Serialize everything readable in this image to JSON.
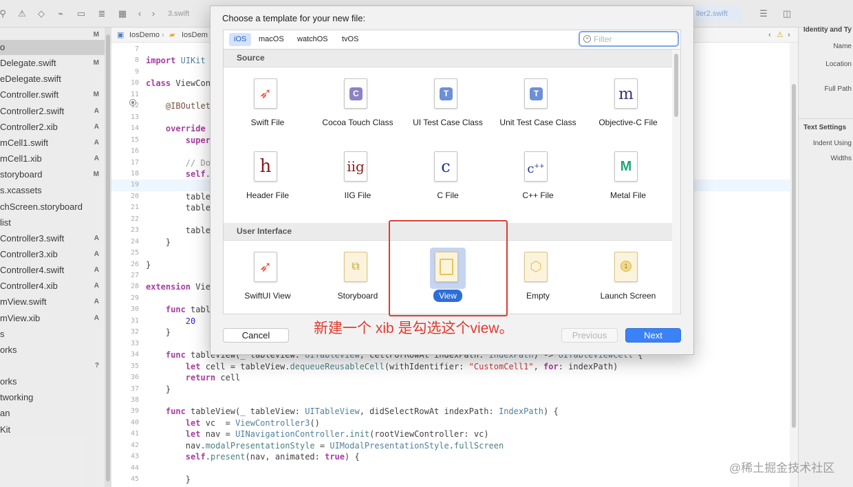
{
  "toolbar": {
    "tabs": [
      "3.swift",
      "ller2.swift"
    ]
  },
  "navigator": {
    "header_status": "M",
    "items": [
      {
        "name": "o",
        "status": "",
        "selected": true
      },
      {
        "name": "Delegate.swift",
        "status": "M"
      },
      {
        "name": "eDelegate.swift",
        "status": ""
      },
      {
        "name": "Controller.swift",
        "status": "M"
      },
      {
        "name": "Controller2.swift",
        "status": "A"
      },
      {
        "name": "Controller2.xib",
        "status": "A"
      },
      {
        "name": "mCell1.swift",
        "status": "A"
      },
      {
        "name": "mCell1.xib",
        "status": "A"
      },
      {
        "name": "storyboard",
        "status": "M"
      },
      {
        "name": "s.xcassets",
        "status": ""
      },
      {
        "name": "chScreen.storyboard",
        "status": ""
      },
      {
        "name": "list",
        "status": ""
      },
      {
        "name": "Controller3.swift",
        "status": "A"
      },
      {
        "name": "Controller3.xib",
        "status": "A"
      },
      {
        "name": "Controller4.swift",
        "status": "A"
      },
      {
        "name": "Controller4.xib",
        "status": "A"
      },
      {
        "name": "mView.swift",
        "status": "A"
      },
      {
        "name": "mView.xib",
        "status": "A"
      },
      {
        "name": "s",
        "status": ""
      },
      {
        "name": "orks",
        "status": ""
      },
      {
        "name": "",
        "status": "?"
      },
      {
        "name": "orks",
        "status": ""
      },
      {
        "name": "tworking",
        "status": ""
      },
      {
        "name": "an",
        "status": ""
      },
      {
        "name": "Kit",
        "status": ""
      }
    ]
  },
  "jumpbar": {
    "project": "IosDemo",
    "folder": "IosDem"
  },
  "editor": {
    "lines": [
      {
        "n": "7",
        "code": ""
      },
      {
        "n": "8",
        "code": "import UIKit"
      },
      {
        "n": "9",
        "code": ""
      },
      {
        "n": "10",
        "code": "class ViewCon"
      },
      {
        "n": "11",
        "code": ""
      },
      {
        "n": "12",
        "code": "    @IBOutlet"
      },
      {
        "n": "13",
        "code": ""
      },
      {
        "n": "14",
        "code": "    override"
      },
      {
        "n": "15",
        "code": "        super"
      },
      {
        "n": "16",
        "code": ""
      },
      {
        "n": "17",
        "code": "        // Do"
      },
      {
        "n": "18",
        "code": "        self."
      },
      {
        "n": "19",
        "code": ""
      },
      {
        "n": "20",
        "code": "        table"
      },
      {
        "n": "21",
        "code": "        table"
      },
      {
        "n": "22",
        "code": ""
      },
      {
        "n": "23",
        "code": "        table"
      },
      {
        "n": "24",
        "code": "    }"
      },
      {
        "n": "25",
        "code": ""
      },
      {
        "n": "26",
        "code": "}"
      },
      {
        "n": "27",
        "code": ""
      },
      {
        "n": "28",
        "code": "extension Vie"
      },
      {
        "n": "29",
        "code": ""
      },
      {
        "n": "30",
        "code": "    func table"
      },
      {
        "n": "31",
        "code": "        20"
      },
      {
        "n": "32",
        "code": "    }"
      },
      {
        "n": "33",
        "code": ""
      },
      {
        "n": "34",
        "code": "    func tableView(_ tableView: UITableView, cellForRowAt indexPath: IndexPath) -> UITableViewCell {"
      },
      {
        "n": "35",
        "code": "        let cell = tableView.dequeueReusableCell(withIdentifier: \"CustomCell1\", for: indexPath)"
      },
      {
        "n": "36",
        "code": "        return cell"
      },
      {
        "n": "37",
        "code": "    }"
      },
      {
        "n": "38",
        "code": ""
      },
      {
        "n": "39",
        "code": "    func tableView(_ tableView: UITableView, didSelectRowAt indexPath: IndexPath) {"
      },
      {
        "n": "40",
        "code": "        let vc  = ViewController3()"
      },
      {
        "n": "41",
        "code": "        let nav = UINavigationController.init(rootViewController: vc)"
      },
      {
        "n": "42",
        "code": "        nav.modalPresentationStyle = UIModalPresentationStyle.fullScreen"
      },
      {
        "n": "43",
        "code": "        self.present(nav, animated: true) {"
      },
      {
        "n": "44",
        "code": ""
      },
      {
        "n": "45",
        "code": "        }"
      }
    ]
  },
  "inspector": {
    "identity_title": "Identity and Ty",
    "name_label": "Name",
    "location_label": "Location",
    "full_path_label": "Full Path",
    "text_settings_title": "Text Settings",
    "indent_label": "Indent Using",
    "widths_label": "Widths"
  },
  "dialog": {
    "title": "Choose a template for your new file:",
    "platforms": [
      "iOS",
      "macOS",
      "watchOS",
      "tvOS"
    ],
    "selected_platform": "iOS",
    "filter_placeholder": "Filter",
    "sections": [
      {
        "header": "Source",
        "templates": [
          {
            "label": "Swift File",
            "icon": "swift-file-icon"
          },
          {
            "label": "Cocoa Touch Class",
            "icon": "cocoa-touch-class-icon"
          },
          {
            "label": "UI Test Case Class",
            "icon": "ui-test-case-class-icon"
          },
          {
            "label": "Unit Test Case Class",
            "icon": "unit-test-case-class-icon"
          },
          {
            "label": "Objective-C File",
            "icon": "objective-c-file-icon"
          },
          {
            "label": "Header File",
            "icon": "header-file-icon"
          },
          {
            "label": "IIG File",
            "icon": "iig-file-icon"
          },
          {
            "label": "C File",
            "icon": "c-file-icon"
          },
          {
            "label": "C++ File",
            "icon": "cpp-file-icon"
          },
          {
            "label": "Metal File",
            "icon": "metal-file-icon"
          }
        ]
      },
      {
        "header": "User Interface",
        "templates": [
          {
            "label": "SwiftUI View",
            "icon": "swiftui-view-icon"
          },
          {
            "label": "Storyboard",
            "icon": "storyboard-icon"
          },
          {
            "label": "View",
            "icon": "view-icon",
            "selected": true
          },
          {
            "label": "Empty",
            "icon": "empty-icon"
          },
          {
            "label": "Launch Screen",
            "icon": "launch-screen-icon"
          }
        ]
      }
    ],
    "cancel_label": "Cancel",
    "previous_label": "Previous",
    "next_label": "Next"
  },
  "annotation": {
    "text": "新建一个 xib 是勾选这个view。",
    "color": "#e03a2e"
  },
  "watermark": "@稀土掘金技术社区",
  "colors": {
    "accent": "#3b82f6",
    "selection": "#2e6ed9",
    "annotation_red": "#e03a2e"
  }
}
